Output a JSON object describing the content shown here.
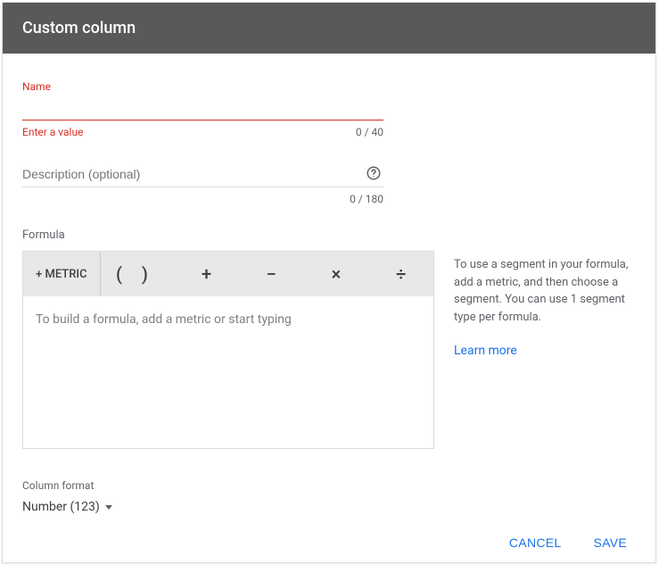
{
  "header": {
    "title": "Custom column"
  },
  "name_field": {
    "label": "Name",
    "error": "Enter a value",
    "counter": "0 / 40",
    "value": ""
  },
  "description_field": {
    "placeholder": "Description (optional)",
    "counter": "0 / 180",
    "value": ""
  },
  "formula": {
    "label": "Formula",
    "metric_button": "+ METRIC",
    "operators": {
      "parens": "()",
      "plus": "+",
      "minus": "−",
      "multiply": "×",
      "divide": "÷"
    },
    "placeholder": "To build a formula, add a metric or start typing",
    "help_text": "To use a segment in your formula, add a metric, and then choose a segment. You can use 1 segment type per formula.",
    "learn_more": "Learn more"
  },
  "column_format": {
    "label": "Column format",
    "selected": "Number (123)"
  },
  "footer": {
    "cancel": "CANCEL",
    "save": "SAVE"
  }
}
